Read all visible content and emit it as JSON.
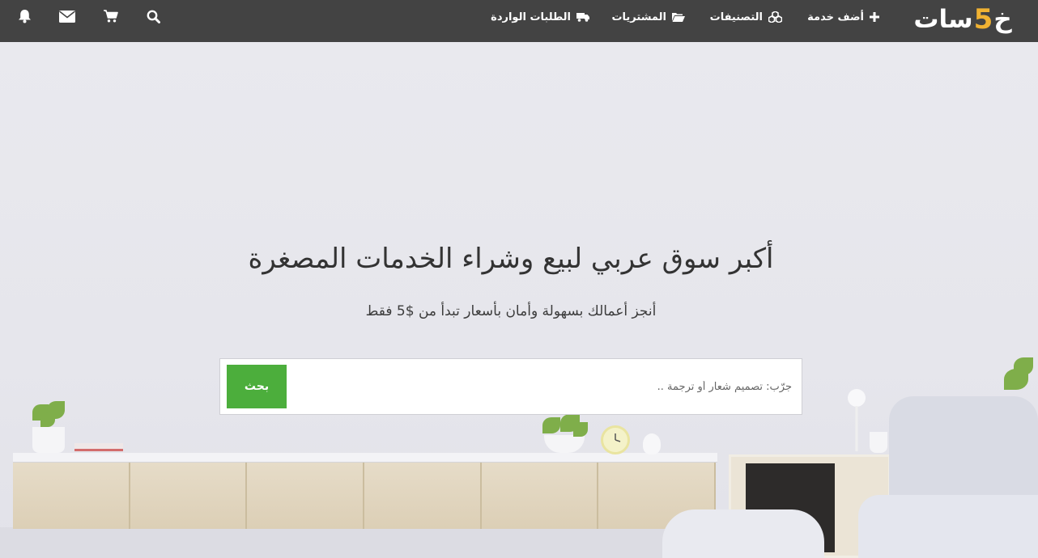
{
  "nav": {
    "logo": {
      "before": "خ",
      "digit": "5",
      "after": "سات"
    },
    "items": [
      {
        "label": "أضف خدمة",
        "icon": "plus-icon"
      },
      {
        "label": "التصنيفات",
        "icon": "cubes-icon"
      },
      {
        "label": "المشتريات",
        "icon": "folder-open-icon"
      },
      {
        "label": "الطلبات الواردة",
        "icon": "truck-icon"
      }
    ],
    "icons": [
      "search-icon",
      "cart-icon",
      "envelope-icon",
      "bell-icon"
    ]
  },
  "hero": {
    "title": "أكبر سوق عربي لبيع وشراء الخدمات المصغرة",
    "subtitle": "أنجز أعمالك بسهولة وأمان بأسعار تبدأ من $5 فقط"
  },
  "search": {
    "placeholder": "جرّب: تصميم شعار أو ترجمة ..",
    "value": "",
    "button_label": "بحث"
  },
  "colors": {
    "topbar": "#434343",
    "logo_accent": "#f0b232",
    "search_button": "#4cae3c"
  }
}
